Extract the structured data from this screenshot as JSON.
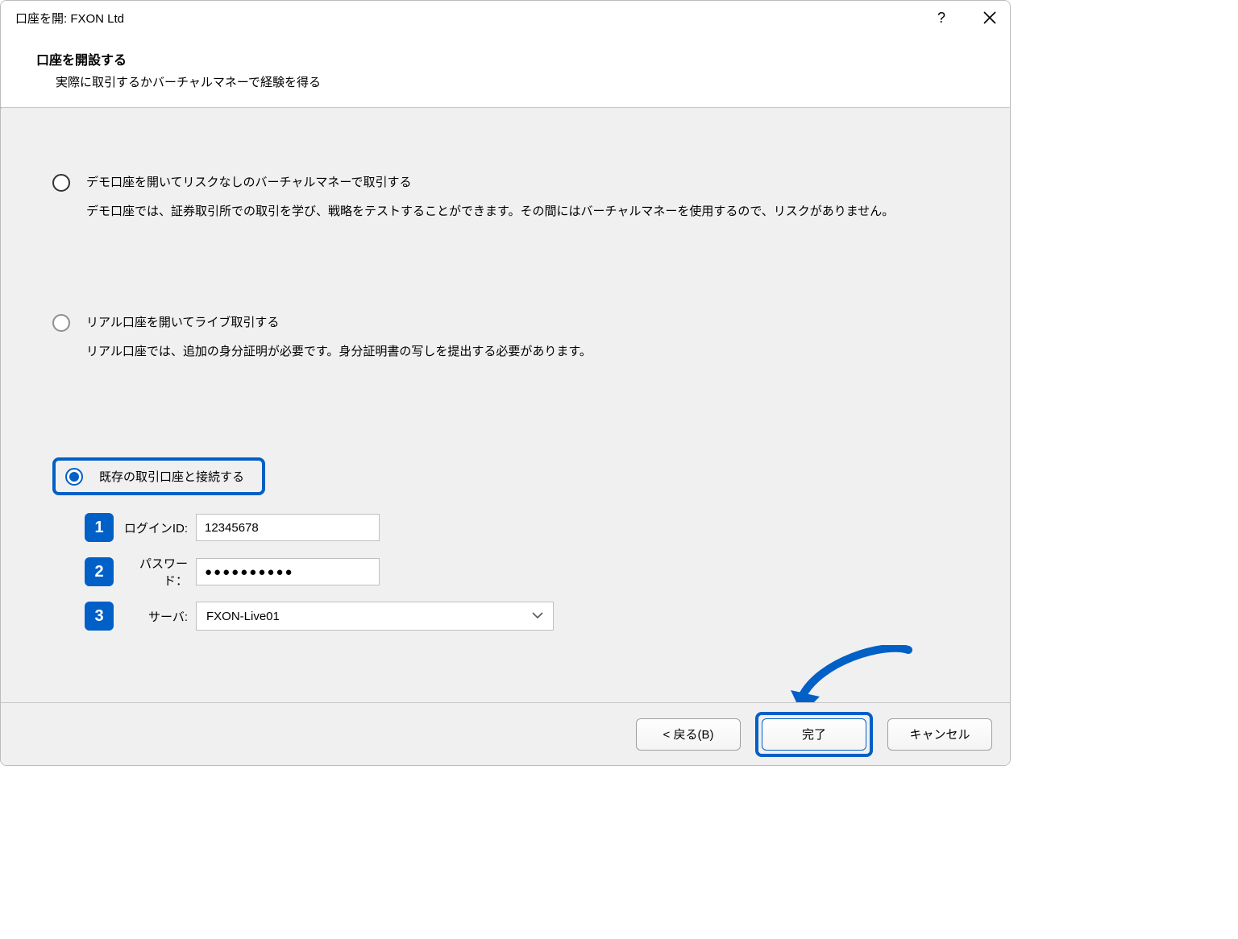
{
  "titlebar": {
    "title": "口座を開: FXON Ltd"
  },
  "header": {
    "title": "口座を開設する",
    "subtitle": "実際に取引するかバーチャルマネーで経験を得る"
  },
  "options": {
    "demo": {
      "title": "デモ口座を開いてリスクなしのバーチャルマネーで取引する",
      "desc": "デモ口座では、証券取引所での取引を学び、戦略をテストすることができます。その間にはバーチャルマネーを使用するので、リスクがありません。"
    },
    "live": {
      "title": "リアル口座を開いてライブ取引する",
      "desc": "リアル口座では、追加の身分証明が必要です。身分証明書の写しを提出する必要があります。"
    },
    "existing": {
      "title": "既存の取引口座と接続する"
    }
  },
  "form": {
    "steps": {
      "login": "1",
      "password": "2",
      "server": "3"
    },
    "login": {
      "label": "ログインID:",
      "value": "12345678"
    },
    "password": {
      "label": "パスワード：",
      "value": "●●●●●●●●●●"
    },
    "server": {
      "label": "サーバ:",
      "value": "FXON-Live01"
    }
  },
  "footer": {
    "back": "< 戻る(B)",
    "finish": "完了",
    "cancel": "キャンセル"
  }
}
